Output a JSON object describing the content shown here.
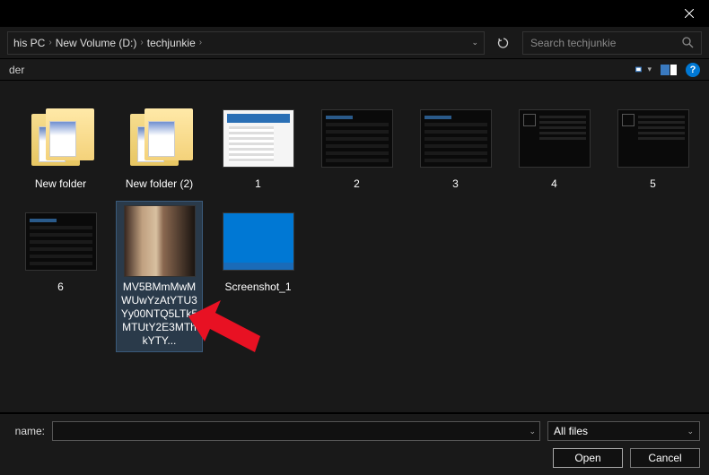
{
  "titlebar": {
    "close_icon": "close"
  },
  "breadcrumb": {
    "parts": [
      "his PC",
      "New Volume (D:)",
      "techjunkie"
    ]
  },
  "search": {
    "placeholder": "Search techjunkie"
  },
  "toolbar": {
    "left_label": "der"
  },
  "items": [
    {
      "name": "New folder",
      "type": "folder"
    },
    {
      "name": "New folder (2)",
      "type": "folder"
    },
    {
      "name": "1",
      "type": "image-light"
    },
    {
      "name": "2",
      "type": "image-dark"
    },
    {
      "name": "3",
      "type": "image-dark"
    },
    {
      "name": "4",
      "type": "image-dark2"
    },
    {
      "name": "5",
      "type": "image-dark2"
    },
    {
      "name": "6",
      "type": "image-dark"
    },
    {
      "name": "MV5BMmMwMWUwYzAtYTU3Yy00NTQ5LTk5MTUtY2E3MThkYTY...",
      "type": "image-person",
      "selected": true
    },
    {
      "name": "Screenshot_1",
      "type": "image-desktop"
    }
  ],
  "bottom": {
    "name_label": "name:",
    "filename_value": "",
    "filetype_value": "All files",
    "open_label": "Open",
    "cancel_label": "Cancel"
  },
  "help_glyph": "?"
}
